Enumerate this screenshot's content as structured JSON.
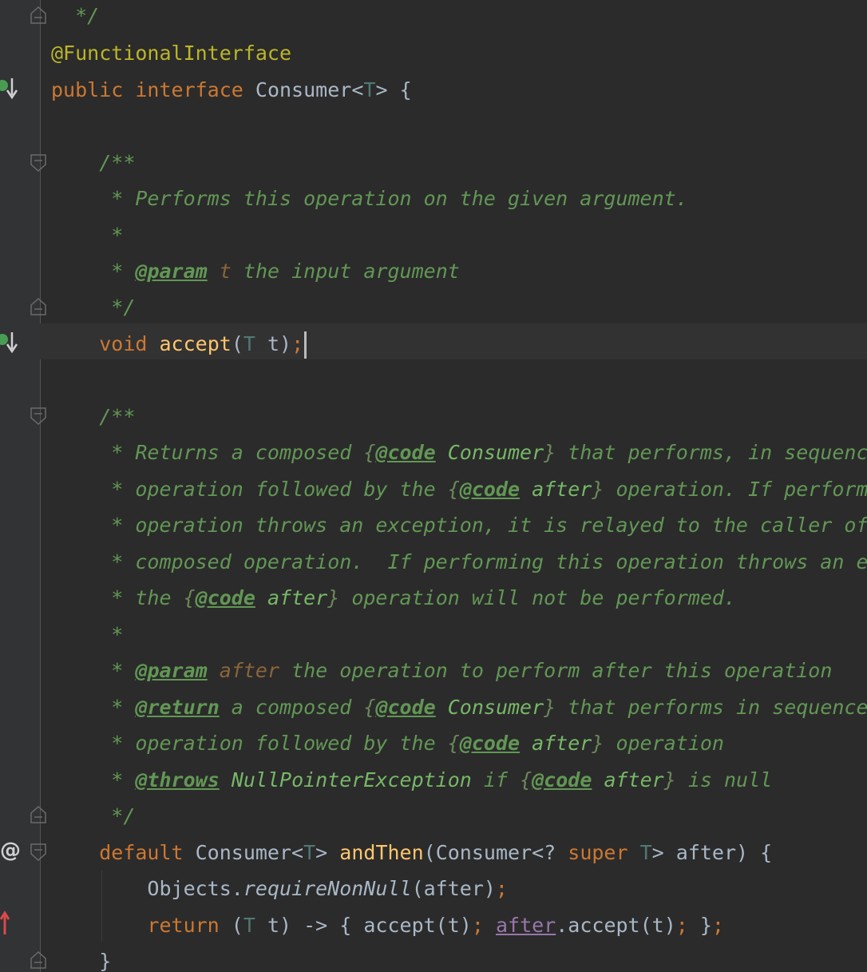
{
  "editor": {
    "lines": {
      "l0": "*/",
      "l1_ann": "@FunctionalInterface",
      "l2_public": "public",
      "l2_interface": "interface",
      "l2_name": "Consumer",
      "l2_lt": "<",
      "l2_T": "T",
      "l2_gt": ">",
      "l2_brace": "{",
      "l4_open": "/**",
      "l5": "* Performs this operation on the given argument.",
      "l6": "*",
      "l7_star": "*",
      "l7_tag": "@param",
      "l7_var": "t",
      "l7_rest": "the input argument",
      "l8_close": "*/",
      "l9_void": "void",
      "l9_fn": "accept",
      "l9_lp": "(",
      "l9_T": "T",
      "l9_t": " t)",
      "l9_semi": ";",
      "l11_open": "/**",
      "l12_a": "* Returns a composed ",
      "l12_b1": "{",
      "l12_tag": "@code",
      "l12_code": " Consumer",
      "l12_b2": "}",
      "l12_c": " that performs, in sequenc",
      "l13_a": "* operation followed by the ",
      "l13_b1": "{",
      "l13_tag": "@code",
      "l13_code": " after",
      "l13_b2": "}",
      "l13_c": " operation. If perform",
      "l14": "* operation throws an exception, it is relayed to the caller of",
      "l15": "* composed operation.  If performing this operation throws an e",
      "l16_a": "* the ",
      "l16_b1": "{",
      "l16_tag": "@code",
      "l16_code": " after",
      "l16_b2": "}",
      "l16_c": " operation will not be performed.",
      "l17": "*",
      "l18_star": "*",
      "l18_tag": "@param",
      "l18_var": "after",
      "l18_rest": "the operation to perform after this operation",
      "l19_star": "*",
      "l19_tag": "@return",
      "l19_a": " a composed ",
      "l19_b1": "{",
      "l19_tag2": "@code",
      "l19_code": " Consumer",
      "l19_b2": "}",
      "l19_c": " that performs in sequence",
      "l20_a": "* operation followed by the ",
      "l20_b1": "{",
      "l20_tag": "@code",
      "l20_code": " after",
      "l20_b2": "}",
      "l20_c": " operation",
      "l21_star": "*",
      "l21_tag": "@throws",
      "l21_ex": "NullPointerException",
      "l21_a": " if ",
      "l21_b1": "{",
      "l21_tag2": "@code",
      "l21_code": " after",
      "l21_b2": "}",
      "l21_c": " is null",
      "l22_close": "*/",
      "l23_default": "default",
      "l23_type": " Consumer",
      "l23_lt": "<",
      "l23_T": "T",
      "l23_gt": ">",
      "l23_fn": "andThen",
      "l23_a": "(Consumer<? ",
      "l23_super": "super",
      "l23_T2": "T",
      "l23_b": "> after) {",
      "l24_obj": "Objects.",
      "l24_fn": "requireNonNull",
      "l24_arg": "(after)",
      "l24_semi": ";",
      "l25_return": "return",
      "l25_a": " (",
      "l25_T": "T",
      "l25_b": " t) -> { accept(t)",
      "l25_semi": ";",
      "l25_field": "after",
      "l25_c": ".accept(t)",
      "l25_semi2": ";",
      "l25_d": " }",
      "l25_semi3": ";",
      "l26": "}"
    }
  },
  "gutter": {
    "markers": [
      "implemented-icon",
      "implemented-icon",
      "override-icon",
      "recursive-call-icon"
    ]
  },
  "colors": {
    "background": "#2b2b2b",
    "keyword": "#cc7832",
    "annotation": "#bbb529",
    "doc_comment": "#629755",
    "method": "#ffc66d",
    "type_param": "#507874",
    "text": "#a9b7c6"
  }
}
